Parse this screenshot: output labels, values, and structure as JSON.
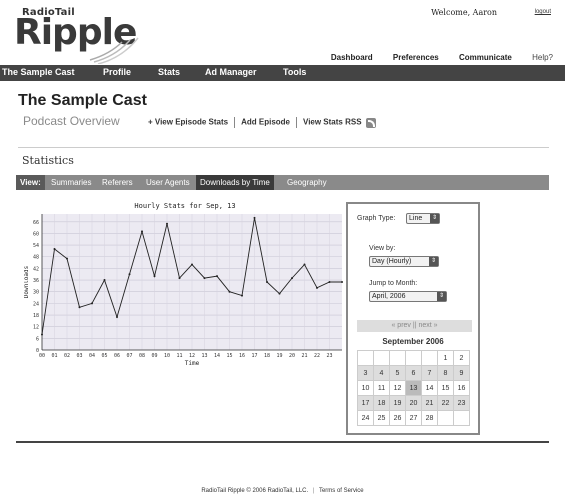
{
  "header": {
    "logo_small": "RadioTail",
    "logo_big": "Ripple",
    "welcome": "Welcome, Aaron",
    "logout": "logout",
    "topnav": [
      "Dashboard",
      "Preferences",
      "Communicate",
      "Help?"
    ]
  },
  "mainnav": [
    "The Sample Cast",
    "Profile",
    "Stats",
    "Ad Manager",
    "Tools"
  ],
  "page": {
    "title": "The Sample Cast",
    "subtitle": "Podcast Overview",
    "links": [
      "+ View Episode Stats",
      "Add Episode",
      "View Stats RSS"
    ]
  },
  "stats": {
    "title": "Statistics",
    "tabs": [
      "View:",
      "Summaries",
      "Referers",
      "User Agents",
      "Downloads by Time",
      "Geography"
    ]
  },
  "sidebar": {
    "graph_type_label": "Graph Type:",
    "graph_type_value": "Line",
    "view_by_label": "View by:",
    "view_by_value": "Day (Hourly)",
    "jump_label": "Jump to Month:",
    "jump_value": "April, 2006",
    "prevnext": "« prev || next »",
    "calendar_month": "September 2006",
    "calendar": [
      [
        "",
        "",
        "",
        "",
        "",
        "1",
        "2"
      ],
      [
        "3",
        "4",
        "5",
        "6",
        "7",
        "8",
        "9"
      ],
      [
        "10",
        "11",
        "12",
        "13",
        "14",
        "15",
        "16"
      ],
      [
        "17",
        "18",
        "19",
        "20",
        "21",
        "22",
        "23"
      ],
      [
        "24",
        "25",
        "26",
        "27",
        "28",
        "",
        ""
      ]
    ]
  },
  "footer": {
    "copyright": "RadioTail Ripple © 2006",
    "company": "RadioTail, LLC.",
    "terms": "Terms of Service"
  },
  "chart_data": {
    "type": "line",
    "title": "Hourly Stats for Sep, 13",
    "xlabel": "Time",
    "ylabel": "Downloads",
    "x": [
      "00",
      "01",
      "02",
      "03",
      "04",
      "05",
      "06",
      "07",
      "08",
      "09",
      "10",
      "11",
      "12",
      "13",
      "14",
      "15",
      "16",
      "17",
      "18",
      "19",
      "20",
      "21",
      "22",
      "23"
    ],
    "yticks": [
      0,
      6,
      12,
      18,
      24,
      30,
      36,
      42,
      48,
      54,
      60,
      66
    ],
    "ylim": [
      0,
      70
    ],
    "values": [
      8,
      52,
      47,
      22,
      24,
      36,
      17,
      39,
      61,
      38,
      65,
      37,
      44,
      37,
      38,
      30,
      28,
      68,
      35,
      29,
      37,
      44,
      32,
      35,
      35
    ],
    "grid": true
  }
}
